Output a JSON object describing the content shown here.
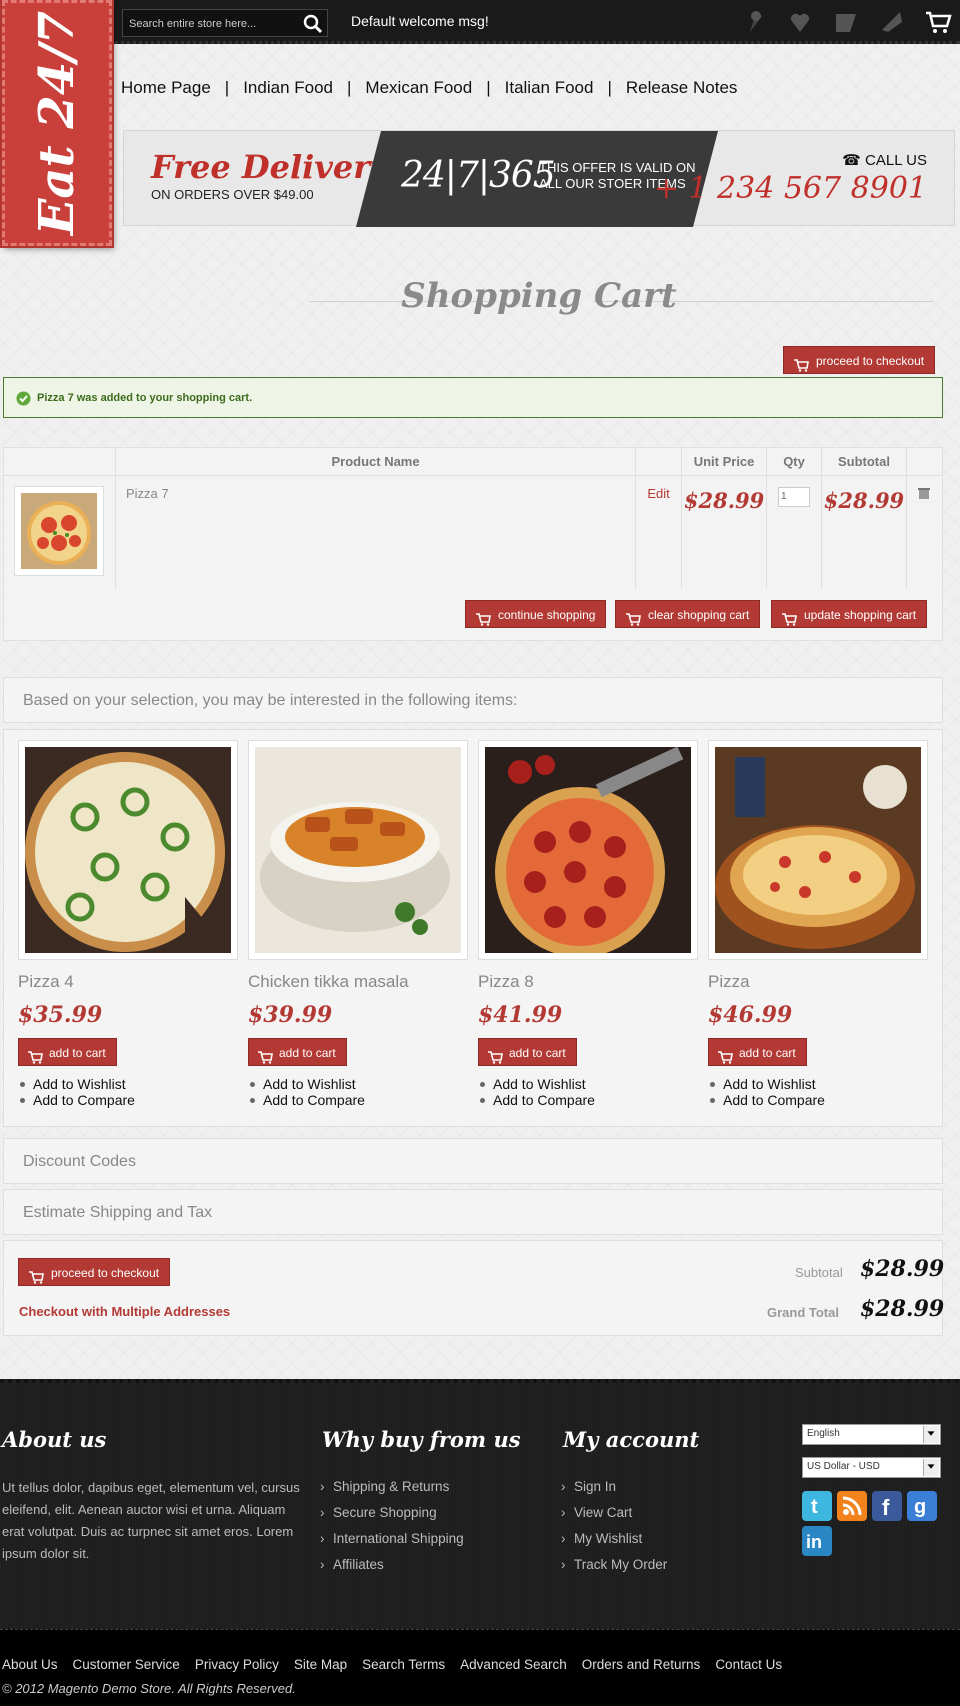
{
  "search": {
    "placeholder": "Search entire store here..."
  },
  "header": {
    "welcome": "Default welcome msg!",
    "logo": "Eat 24/7",
    "nav": [
      "Home Page",
      "Indian Food",
      "Mexican Food",
      "Italian Food",
      "Release Notes"
    ],
    "nav_separator": "|",
    "top_icons": [
      "bookmark-icon",
      "heart-icon",
      "compare-icon",
      "checkout-icon",
      "shopping-cart-icon"
    ]
  },
  "banner": {
    "free_delivery": "Free Delivery",
    "free_delivery_sub": "ON ORDERS OVER $49.00",
    "big": "24|7|365",
    "offer": "THIS OFFER IS VALID ON ALL OUR STOER ITEMS",
    "call_us": "CALL US",
    "phone": "+ 1 234 567 8901"
  },
  "page": {
    "title": "Shopping Cart",
    "proceed_label": "proceed to checkout",
    "success_msg": "Pizza 7 was added to your shopping cart."
  },
  "cart": {
    "headers": {
      "product": "Product Name",
      "unit_price": "Unit Price",
      "qty": "Qty",
      "subtotal": "Subtotal"
    },
    "item": {
      "name": "Pizza 7",
      "edit": "Edit",
      "unit_price": "$28.99",
      "qty": "1",
      "subtotal": "$28.99"
    },
    "continue_label": "continue shopping",
    "clear_label": "clear shopping cart",
    "update_label": "update shopping cart"
  },
  "crosssell": {
    "heading": "Based on your selection, you may be interested in the following items:",
    "add_to_cart": "add to cart",
    "wishlist": "Add to Wishlist",
    "compare": "Add to Compare",
    "items": [
      {
        "name": "Pizza 4",
        "price": "$35.99"
      },
      {
        "name": "Chicken tikka masala",
        "price": "$39.99"
      },
      {
        "name": "Pizza 8",
        "price": "$41.99"
      },
      {
        "name": "Pizza",
        "price": "$46.99"
      }
    ]
  },
  "discount": {
    "label": "Discount Codes"
  },
  "shipping": {
    "label": "Estimate Shipping and Tax"
  },
  "totals": {
    "proceed_label": "proceed to checkout",
    "multi_label": "Checkout with Multiple Addresses",
    "subtotal_label": "Subtotal",
    "subtotal_value": "$28.99",
    "grand_label": "Grand Total",
    "grand_value": "$28.99"
  },
  "footer": {
    "about_title": "About us",
    "about_text": "Ut tellus dolor, dapibus eget, elementum vel, cursus eleifend, elit. Aenean auctor wisi et urna. Aliquam erat volutpat. Duis ac turpnec sit amet eros. Lorem ipsum dolor sit.",
    "why_title": "Why buy from us",
    "why_links": [
      "Shipping & Returns",
      "Secure Shopping",
      "International Shipping",
      "Affiliates"
    ],
    "account_title": "My account",
    "account_links": [
      "Sign In",
      "View Cart",
      "My Wishlist",
      "Track My Order"
    ],
    "language": "English",
    "currency": "US Dollar - USD",
    "social": [
      "twitter-icon",
      "rss-icon",
      "facebook-icon",
      "google-icon",
      "linkedin-icon"
    ],
    "bottom_links": [
      "About Us",
      "Customer Service",
      "Privacy Policy",
      "Site Map",
      "Search Terms",
      "Advanced Search",
      "Orders and Returns",
      "Contact Us"
    ],
    "copyright": "© 2012 Magento Demo Store. All Rights Reserved."
  },
  "colors": {
    "accent": "#b33a34",
    "footer_bg": "#1e1e1e",
    "success_border": "#4a7a2e"
  }
}
